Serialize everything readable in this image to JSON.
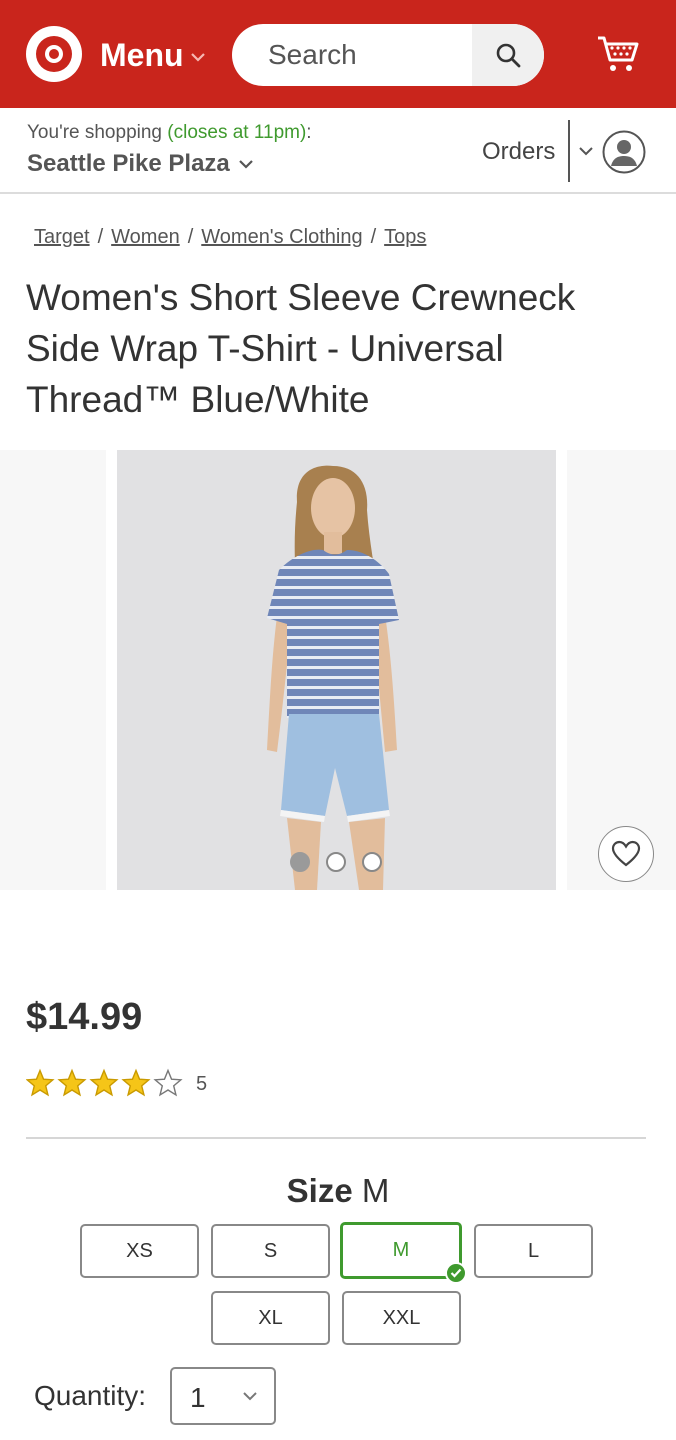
{
  "header": {
    "menu_label": "Menu",
    "search_placeholder": "Search",
    "icons": [
      "target-logo-icon",
      "chevron-down-icon",
      "search-icon",
      "cart-icon"
    ],
    "brand_color": "#c9251c"
  },
  "store_bar": {
    "prefix": "You're shopping ",
    "hours": "(closes at 11pm)",
    "suffix": ":",
    "store_name": "Seattle Pike Plaza",
    "orders_label": "Orders",
    "icons": [
      "chevron-down-icon",
      "account-avatar-icon"
    ]
  },
  "breadcrumb": [
    "Target",
    "Women",
    "Women's Clothing",
    "Tops"
  ],
  "product": {
    "title": "Women's Short Sleeve Crewneck Side Wrap T-Shirt - Universal Thread™ Blue/White",
    "price": "$14.99",
    "rating": 4,
    "rating_max": 5,
    "review_count": "5",
    "gallery_active_index": 0,
    "gallery_count": 3
  },
  "size": {
    "label": "Size",
    "selected": "M",
    "options": [
      "XS",
      "S",
      "M",
      "L",
      "XL",
      "XXL"
    ]
  },
  "quantity": {
    "label": "Quantity:",
    "value": "1"
  },
  "colors": {
    "accent_green": "#3f9a2e",
    "star": "#f5c518"
  }
}
